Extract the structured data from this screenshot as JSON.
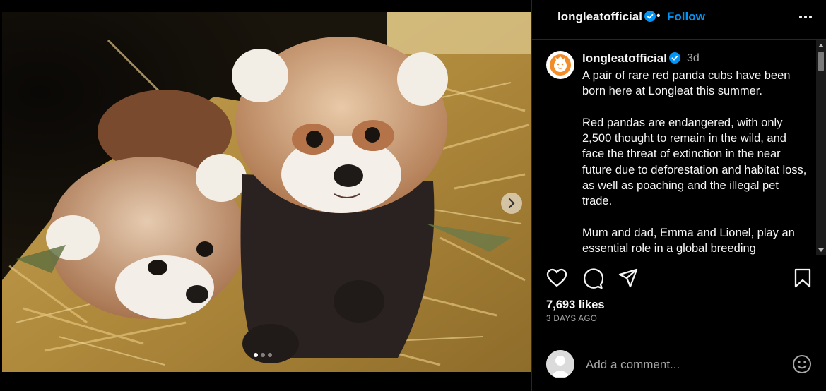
{
  "post": {
    "username": "longleatofficial",
    "separator": "•",
    "follow_label": "Follow",
    "time_ago": "3d",
    "caption": "A pair of rare red panda cubs have been born here at Longleat this summer.\n\nRed pandas are endangered, with only 2,500 thought to remain in the wild, and face the threat of extinction in the near future due to deforestation and habitat loss, as well as poaching and the illegal pet trade.\n\nMum and dad, Emma and Lionel, play an essential role in a global breeding",
    "likes": "7,693 likes",
    "age": "3 DAYS AGO"
  },
  "comment": {
    "placeholder": "Add a comment..."
  },
  "carousel": {
    "count": 3,
    "active_index": 0
  },
  "icons": {
    "verified": "verified-badge-icon",
    "more": "more-options-icon",
    "like": "heart-icon",
    "comment": "comment-icon",
    "share": "share-icon",
    "save": "bookmark-icon",
    "emoji": "emoji-icon",
    "next": "chevron-right-icon"
  },
  "colors": {
    "background": "#000000",
    "accent": "#0095f6",
    "verified": "#0095f6",
    "text": "#f5f5f5",
    "secondary_text": "#a8a8a8"
  }
}
